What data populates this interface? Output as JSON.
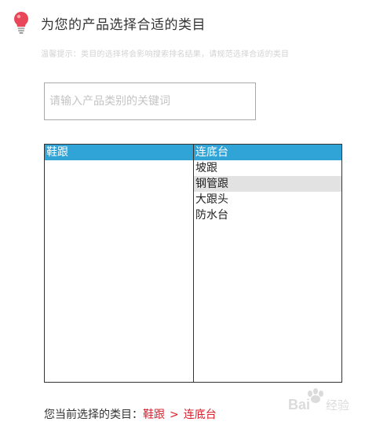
{
  "header": {
    "icon": "lightbulb-icon",
    "title": "为您的产品选择合适的类目"
  },
  "tip": "温馨提示：类目的选择将会影响搜索排名结果，请规范选择合适的类目",
  "search": {
    "placeholder": "请输入产品类别的关键词",
    "value": ""
  },
  "left_list": {
    "items": [
      {
        "label": "鞋跟",
        "state": "selected"
      }
    ]
  },
  "right_list": {
    "items": [
      {
        "label": "连底台",
        "state": "selected"
      },
      {
        "label": "坡跟",
        "state": "normal"
      },
      {
        "label": "钢管跟",
        "state": "hovered"
      },
      {
        "label": "大跟头",
        "state": "normal"
      },
      {
        "label": "防水台",
        "state": "normal"
      }
    ]
  },
  "current": {
    "prefix": "您当前选择的类目：",
    "level1": "鞋跟",
    "separator": ">",
    "level2": "连底台"
  },
  "colors": {
    "selected_bg": "#30a3d7",
    "hover_bg": "#e2e2e2",
    "accent_red": "#d81e2a",
    "bulb": "#e8475a"
  },
  "watermark": {
    "text": "Bai 经验"
  }
}
